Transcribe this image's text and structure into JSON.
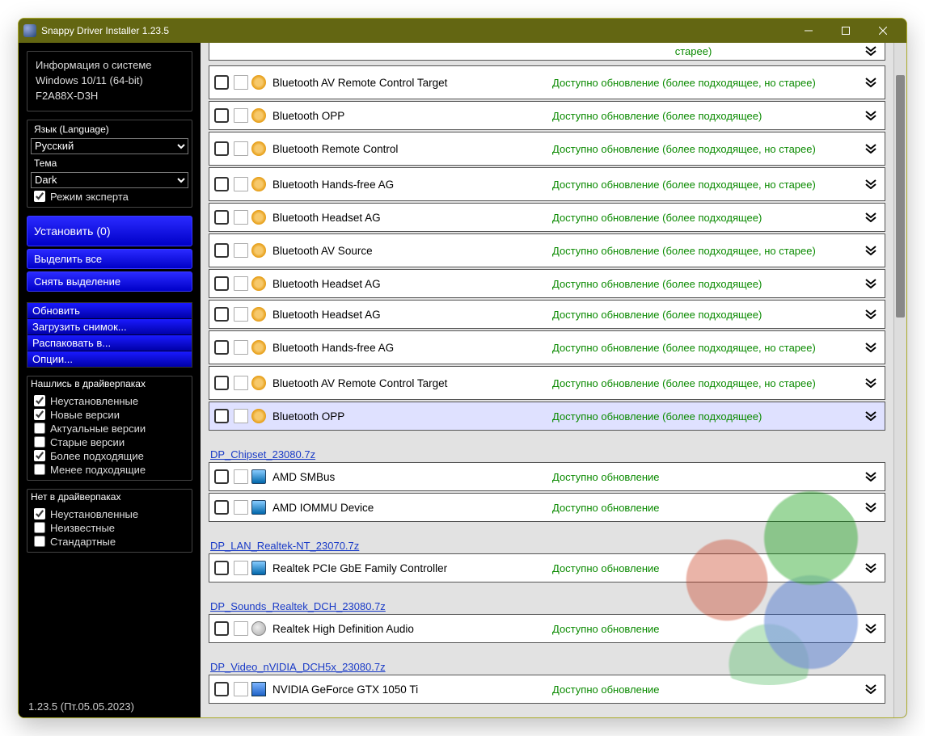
{
  "window": {
    "title": "Snappy Driver Installer 1.23.5"
  },
  "sidebar": {
    "sysinfo": {
      "title": "Информация о системе",
      "os": "Windows 10/11 (64-bit)",
      "board": "F2A88X-D3H"
    },
    "language": {
      "label": "Язык (Language)",
      "value": "Русский"
    },
    "theme": {
      "label": "Тема",
      "value": "Dark"
    },
    "expert_label": "Режим эксперта",
    "actions": {
      "install": "Установить (0)",
      "select_all": "Выделить все",
      "deselect": "Снять выделение"
    },
    "tools": [
      "Обновить",
      "Загрузить снимок...",
      "Распаковать в...",
      "Опции..."
    ],
    "filters_found": {
      "title": "Нашлись в драйверпаках",
      "items": [
        {
          "label": "Неустановленные",
          "checked": true
        },
        {
          "label": "Новые версии",
          "checked": true
        },
        {
          "label": "Актуальные версии",
          "checked": false
        },
        {
          "label": "Старые версии",
          "checked": false
        },
        {
          "label": "Более подходящие",
          "checked": true
        },
        {
          "label": "Менее подходящие",
          "checked": false
        }
      ]
    },
    "filters_missing": {
      "title": "Нет в драйверпаках",
      "items": [
        {
          "label": "Неустановленные",
          "checked": true
        },
        {
          "label": "Неизвестные",
          "checked": false
        },
        {
          "label": "Стандартные",
          "checked": false
        }
      ]
    },
    "version": "1.23.5 (Пт.05.05.2023)"
  },
  "main": {
    "partial_row_status": "старее)",
    "first_group": [
      {
        "name": "Bluetooth AV Remote Control Target",
        "status": "Доступно обновление (более подходящее, но старее)",
        "tall": true,
        "icons": [
          "inf",
          "gear"
        ]
      },
      {
        "name": "Bluetooth OPP",
        "status": "Доступно обновление (более подходящее)",
        "icons": [
          "inf",
          "gear"
        ]
      },
      {
        "name": "Bluetooth Remote Control",
        "status": "Доступно обновление (более подходящее, но старее)",
        "tall": true,
        "icons": [
          "inf",
          "gear"
        ]
      },
      {
        "name": "Bluetooth Hands-free AG",
        "status": "Доступно обновление (более подходящее, но старее)",
        "tall": true,
        "icons": [
          "inf",
          "gear"
        ]
      },
      {
        "name": "Bluetooth Headset AG",
        "status": "Доступно обновление (более подходящее)",
        "icons": [
          "inf",
          "gear"
        ]
      },
      {
        "name": "Bluetooth AV Source",
        "status": "Доступно обновление (более подходящее, но старее)",
        "tall": true,
        "icons": [
          "inf",
          "gear"
        ]
      },
      {
        "name": "Bluetooth Headset AG",
        "status": "Доступно обновление (более подходящее)",
        "icons": [
          "inf",
          "gear"
        ]
      },
      {
        "name": "Bluetooth Headset AG",
        "status": "Доступно обновление (более подходящее)",
        "icons": [
          "inf",
          "gear"
        ]
      },
      {
        "name": "Bluetooth Hands-free AG",
        "status": "Доступно обновление (более подходящее, но старее)",
        "tall": true,
        "icons": [
          "inf",
          "gear"
        ]
      },
      {
        "name": "Bluetooth AV Remote Control Target",
        "status": "Доступно обновление (более подходящее, но старее)",
        "tall": true,
        "icons": [
          "inf",
          "gear"
        ]
      },
      {
        "name": "Bluetooth OPP",
        "status": "Доступно обновление (более подходящее)",
        "icons": [
          "inf",
          "gear"
        ],
        "highlight": true
      }
    ],
    "sections": [
      {
        "title": "DP_Chipset_23080.7z",
        "rows": [
          {
            "name": "AMD SMBus",
            "status": "Доступно обновление",
            "icons": [
              "inf",
              "mon"
            ]
          },
          {
            "name": "AMD IOMMU Device",
            "status": "Доступно обновление",
            "icons": [
              "inf",
              "mon"
            ]
          }
        ]
      },
      {
        "title": "DP_LAN_Realtek-NT_23070.7z",
        "rows": [
          {
            "name": "Realtek PCIe GbE Family Controller",
            "status": "Доступно обновление",
            "icons": [
              "inf",
              "mon"
            ]
          }
        ]
      },
      {
        "title": "DP_Sounds_Realtek_DCH_23080.7z",
        "rows": [
          {
            "name": "Realtek High Definition Audio",
            "status": "Доступно обновление",
            "icons": [
              "inf",
              "spk"
            ]
          }
        ]
      },
      {
        "title": "DP_Video_nVIDIA_DCH5x_23080.7z",
        "rows": [
          {
            "name": "NVIDIA GeForce GTX 1050 Ti",
            "status": "Доступно обновление",
            "icons": [
              "inf",
              "gpu"
            ]
          }
        ]
      }
    ]
  }
}
